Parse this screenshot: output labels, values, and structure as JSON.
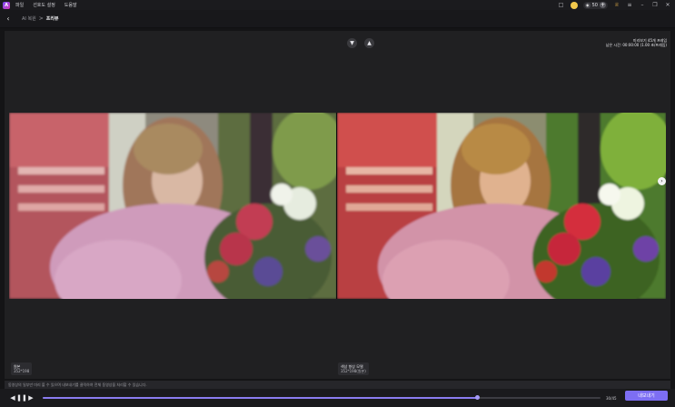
{
  "titlebar": {
    "menu": [
      "파일",
      "선호도 설정",
      "도움말"
    ],
    "credits": "50"
  },
  "breadcrumb": {
    "parent": "AI 복원",
    "separator": ">",
    "current": "프리뷰"
  },
  "preview": {
    "info_line1": "미리보기 45개 프레임",
    "info_line2": "남은 시간: 00:00:00 (1.00 초/프레임)",
    "left_label": "원본",
    "left_size": "352*198",
    "right_label": "색상 향상 모델",
    "right_size": "352*198(원본)"
  },
  "bottom": {
    "notice": "동영상의 일부만 미리 볼 수 있으며 내보내기를 클릭하여 전체 동영상을 처리할 수 있습니다.",
    "frame_count": "30/45",
    "progress": 0.78,
    "export_label": "내보내기"
  },
  "colors": {
    "accent": "#7d6ef3",
    "background": "#202022"
  },
  "icons": {
    "back": "chevron-left-icon",
    "thumbs_down": "thumbs-down-icon",
    "thumbs_up": "thumbs-up-icon",
    "compare_handle": "chevron-right-icon"
  }
}
